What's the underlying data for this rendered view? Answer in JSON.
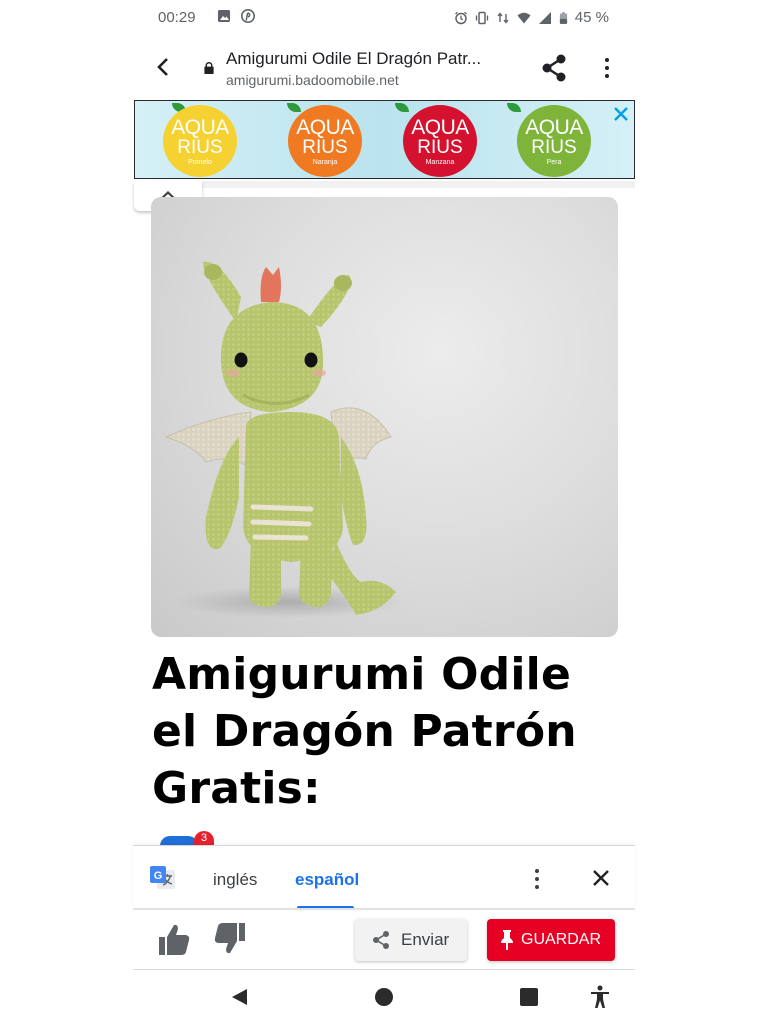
{
  "status_bar": {
    "time": "00:29",
    "battery": "45 %",
    "icons": [
      "image-icon",
      "pinterest-icon",
      "alarm-icon",
      "vibrate-icon",
      "data-arrows-icon",
      "wifi-icon",
      "signal-icon",
      "battery-icon"
    ]
  },
  "browser": {
    "title": "Amigurumi Odile El Dragón Patr...",
    "url": "amigurumi.badoomobile.net",
    "icons": [
      "back-arrow-icon",
      "lock-icon",
      "share-icon",
      "more-vert-icon"
    ]
  },
  "ad": {
    "items": [
      {
        "brand_line1": "AQUA",
        "brand_line2": "RIUS",
        "flavor": "Pomelo",
        "color": "#f5d231"
      },
      {
        "brand_line1": "AQUA",
        "brand_line2": "RIUS",
        "flavor": "Naranja",
        "color": "#f07a22"
      },
      {
        "brand_line1": "AQUA",
        "brand_line2": "RIUS",
        "flavor": "Manzana",
        "color": "#d4122f"
      },
      {
        "brand_line1": "AQUA",
        "brand_line2": "RIUS",
        "flavor": "Pera",
        "color": "#7fb43b"
      }
    ],
    "close_color": "#00a0e3"
  },
  "article": {
    "image_alt": "Amigurumi Odile el Dragón",
    "heading": "Amigurumi Odile el Dragón Patrón Gratis:",
    "badge_count": "3"
  },
  "translate": {
    "source_lang": "inglés",
    "target_lang": "español",
    "accent": "#1a73e8"
  },
  "actions": {
    "send_label": "Enviar",
    "save_label": "GUARDAR",
    "save_color": "#e60023"
  }
}
